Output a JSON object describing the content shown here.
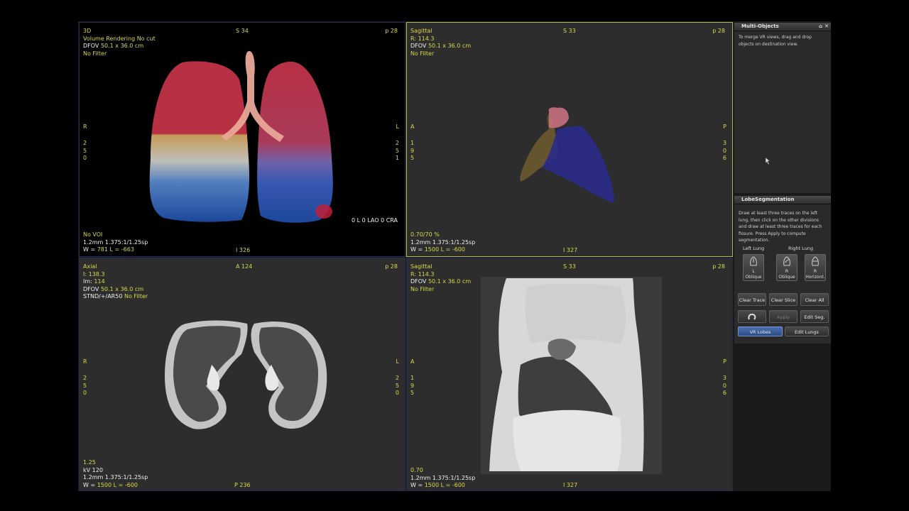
{
  "viewports": {
    "vr3d": {
      "title": "3D",
      "line2": "Volume Rendering No cut",
      "dfov_label": "DFOV",
      "dfov": "50.1 x 36.0 cm",
      "filter": "No Filter",
      "top_center": "S 34",
      "top_right": "p 28",
      "left_dir": "R",
      "right_dir": "L",
      "left_nums": [
        "2",
        "5",
        "0"
      ],
      "right_nums": [
        "2",
        "5",
        "1"
      ],
      "orientation": "0 L 0 LAO 0 CRA",
      "voi": "No VOI",
      "recon": "1.2mm 1.375:1/1.25sp",
      "wl_prefix": "W =",
      "wl": "781 L = -663",
      "bottom_center": "I 326"
    },
    "sagittal_top": {
      "title": "Sagittal",
      "r_label": "R:",
      "r_value": "114.3",
      "dfov_label": "DFOV",
      "dfov": "50.1 x 36.0 cm",
      "filter": "No Filter",
      "top_center": "S 33",
      "top_right": "p 28",
      "left_dir": "A",
      "right_dir": "P",
      "left_nums": [
        "1",
        "9",
        "5"
      ],
      "right_nums": [
        "3",
        "0",
        "6"
      ],
      "zoom": "0.70/70 %",
      "recon": "1.2mm 1.375:1/1.25sp",
      "wl_prefix": "W =",
      "wl": "1500 L = -600",
      "bottom_center": "I 327"
    },
    "axial": {
      "title": "Axial",
      "i_label": "I:",
      "i_value": "138.3",
      "im_label": "Im:",
      "im_value": "114",
      "dfov_label": "DFOV",
      "dfov": "50.1 x 36.0 cm",
      "kernel": "STND/+/AR50",
      "filter": "No Filter",
      "top_center": "A 124",
      "top_right": "p 28",
      "left_dir": "R",
      "right_dir": "L",
      "left_nums": [
        "2",
        "5",
        "0"
      ],
      "right_nums": [
        "2",
        "5",
        "0"
      ],
      "zoom": "1.25",
      "kv": "kV 120",
      "recon": "1.2mm 1.375:1/1.25sp",
      "wl_prefix": "W =",
      "wl": "1500 L = -600",
      "bottom_center": "P 236"
    },
    "sagittal_bottom": {
      "title": "Sagittal",
      "r_label": "R:",
      "r_value": "114.3",
      "dfov_label": "DFOV",
      "dfov": "50.1 x 36.0 cm",
      "filter": "No Filter",
      "top_center": "S 33",
      "top_right": "p 28",
      "left_dir": "A",
      "right_dir": "P",
      "left_nums": [
        "1",
        "9",
        "5"
      ],
      "right_nums": [
        "3",
        "0",
        "6"
      ],
      "zoom": "0.70",
      "recon": "1.2mm 1.375:1/1.25sp",
      "wl_prefix": "W =",
      "wl": "1500 L = -600",
      "bottom_center": "I 327"
    }
  },
  "multi_objects": {
    "title": "Multi-Objects",
    "text": "To merge VR views, drag and drop objects on destination view.",
    "pin_icon": "pin-icon",
    "close_icon": "close-icon"
  },
  "lobe_segmentation": {
    "title": "LobeSegmentation",
    "instructions": "Draw at least three traces on the left lung, then click on the other divisions and draw at least three traces for each fissure. Press Apply to compute segmentation.",
    "left_lung_label": "Left Lung",
    "right_lung_label": "Right Lung",
    "fissures": [
      {
        "line1": "L",
        "line2": "Oblique"
      },
      {
        "line1": "R",
        "line2": "Oblique"
      },
      {
        "line1": "R",
        "line2": "Horizont."
      }
    ],
    "buttons": {
      "clear_trace": "Clear Trace",
      "clear_slice": "Clear Slice",
      "clear_all": "Clear All",
      "apply": "Apply",
      "edit_seg": "Edit Seg.",
      "vr_lobes": "VR Lobes",
      "edit_lungs": "Edit Lungs"
    }
  },
  "colors": {
    "overlay_yellow": "#d8d84a",
    "active_border": "#b9b94a",
    "selected_button": "#3a5c9a"
  }
}
